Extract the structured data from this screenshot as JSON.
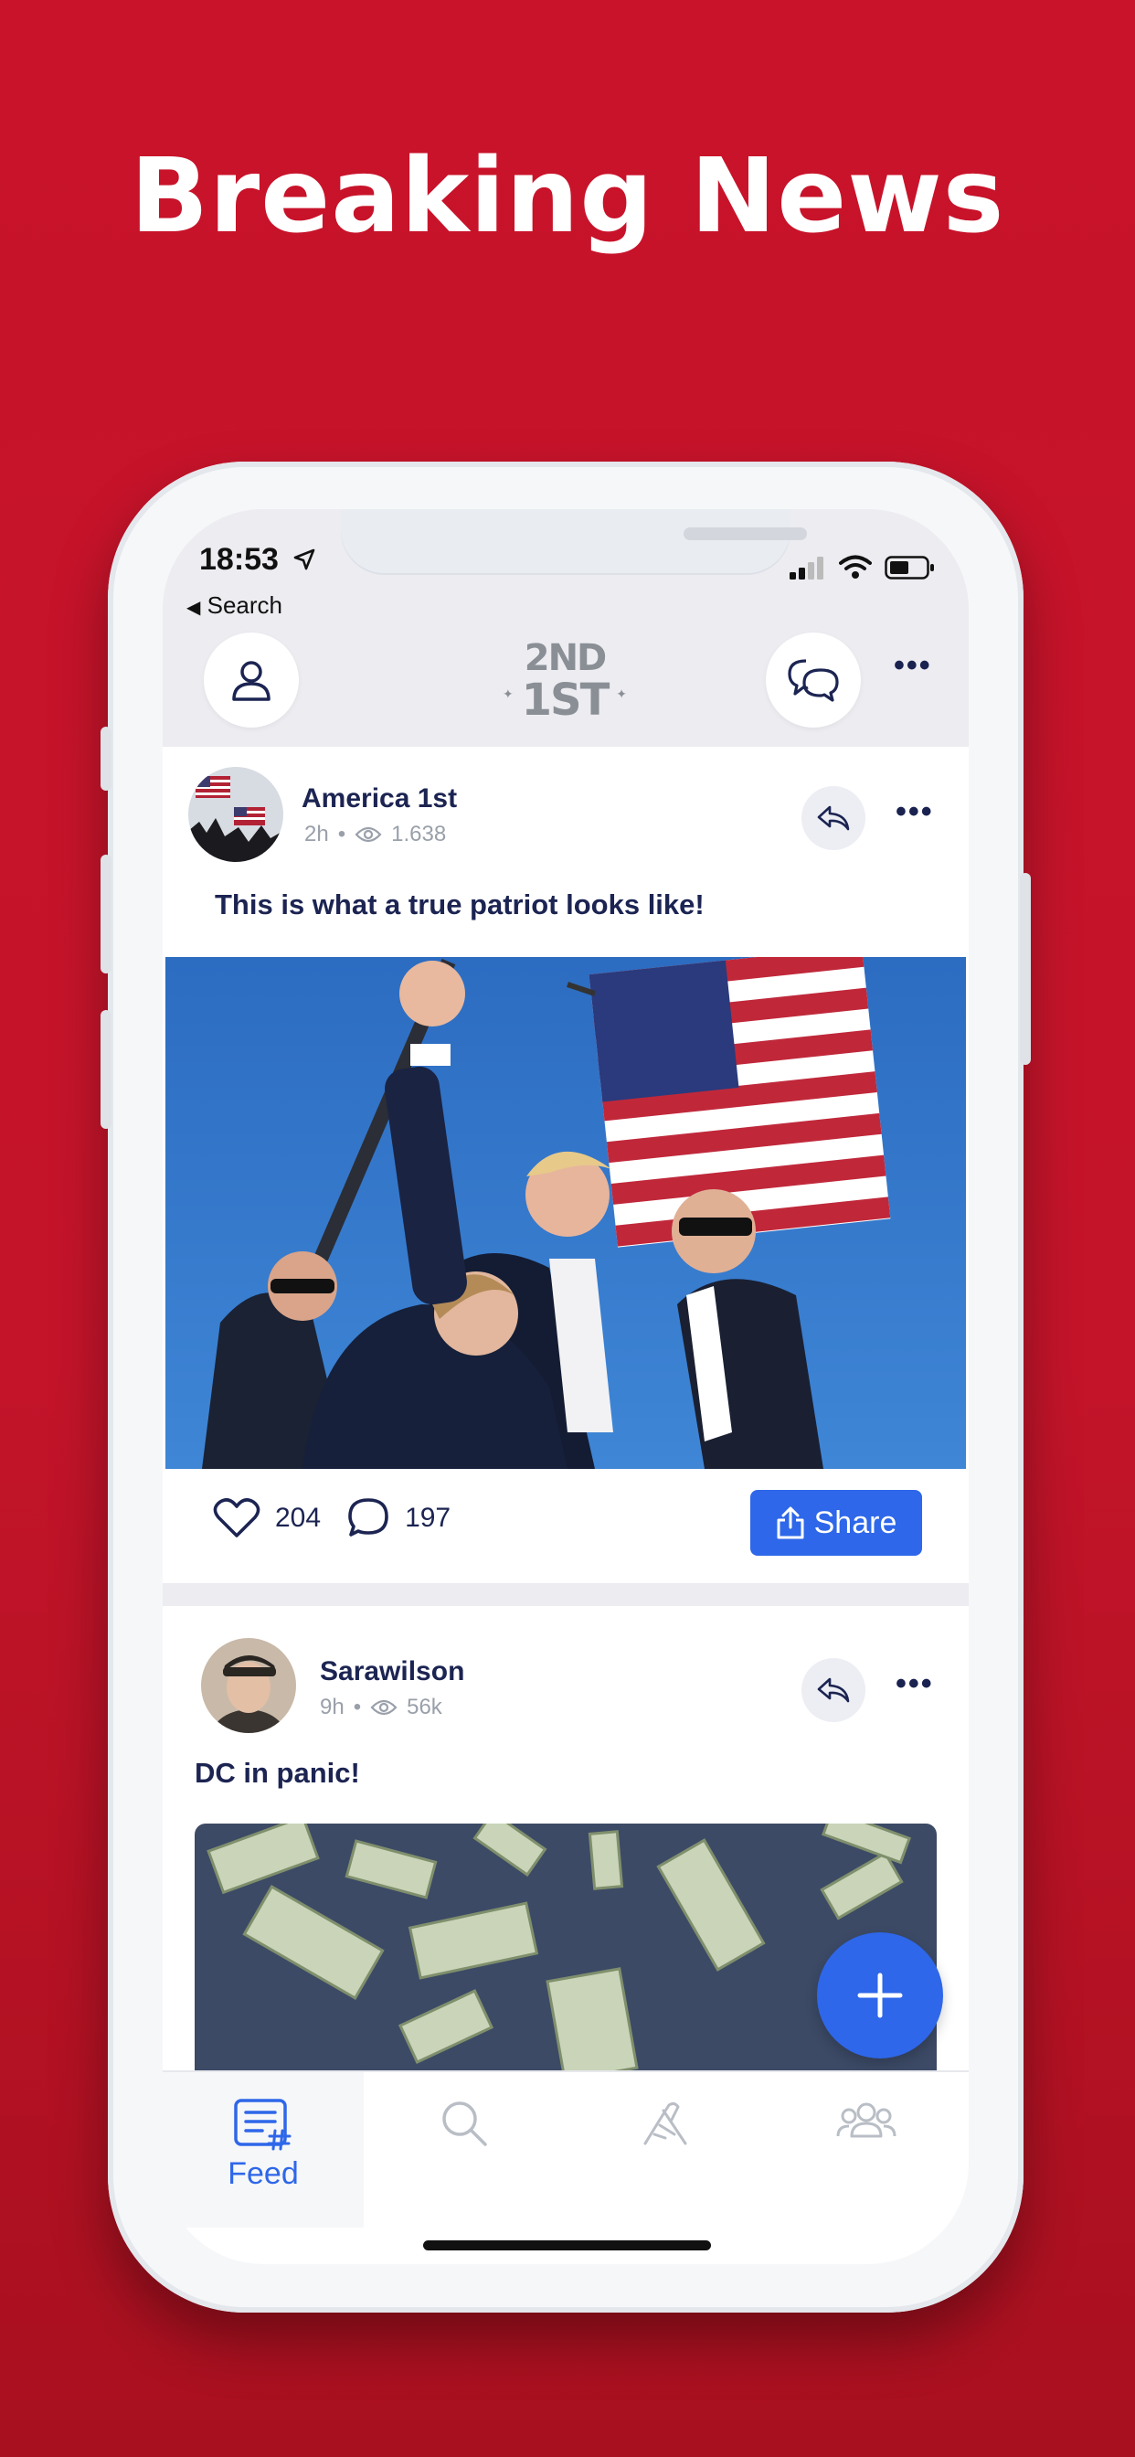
{
  "headline": "Breaking News",
  "status_bar": {
    "time": "18:53",
    "back_label": "Search"
  },
  "header": {
    "logo_line1": "2ND",
    "logo_line2": "1ST",
    "icons": [
      "profile-icon",
      "chat-icon",
      "more-icon"
    ]
  },
  "posts": [
    {
      "author": "America 1st",
      "age": "2h",
      "views": "1.638",
      "text": "This is what a true patriot looks like!",
      "likes": "204",
      "comments": "197",
      "share_label": "Share"
    },
    {
      "author": "Sarawilson",
      "age": "9h",
      "views": "56k",
      "text": "DC in panic!"
    }
  ],
  "tabbar": {
    "tabs": [
      {
        "name": "feed",
        "label": "Feed",
        "icon": "feed-icon",
        "active": true
      },
      {
        "name": "search",
        "icon": "search-icon"
      },
      {
        "name": "handshake",
        "icon": "handshake-icon"
      },
      {
        "name": "groups",
        "icon": "groups-icon"
      }
    ]
  },
  "colors": {
    "background": "#c8132a",
    "accent": "#2e67e9",
    "text_dark": "#1c2452",
    "text_muted": "#9aa0aa"
  }
}
